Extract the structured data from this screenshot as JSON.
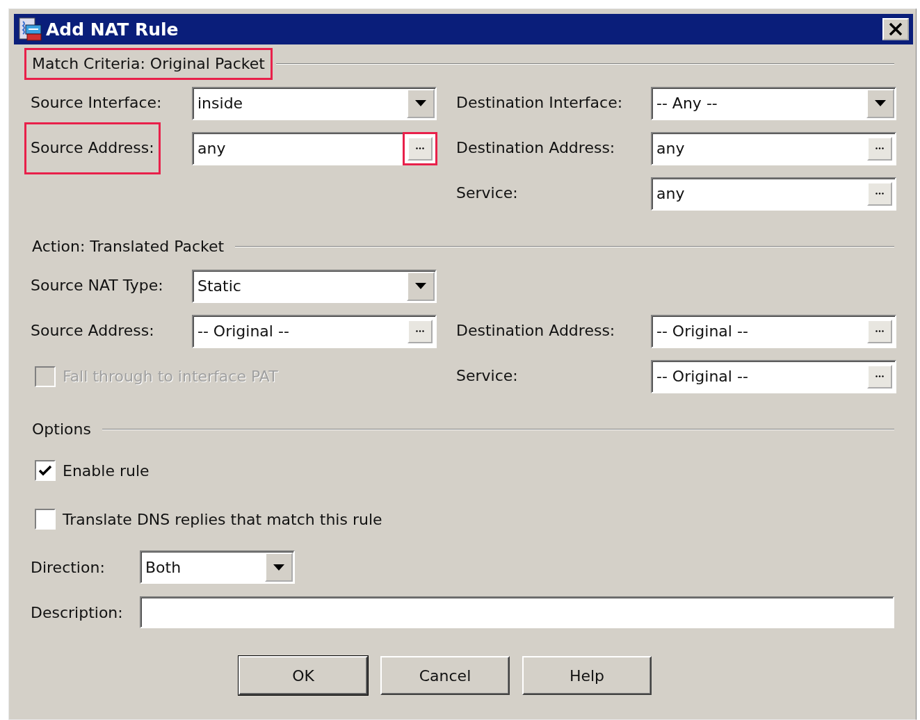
{
  "window": {
    "title": "Add NAT Rule"
  },
  "match": {
    "title": "Match Criteria: Original Packet",
    "highlighted": true,
    "rows": [
      {
        "left": {
          "kind": "dropdown",
          "label": "Source Interface:",
          "value": "inside",
          "label_highlighted": false
        },
        "right": {
          "kind": "dropdown",
          "label": "Destination Interface:",
          "value": "-- Any --",
          "label_highlighted": false
        }
      },
      {
        "left": {
          "kind": "browse",
          "label": "Source Address:",
          "value": "any",
          "label_highlighted": true,
          "button_highlighted": true
        },
        "right": {
          "kind": "browse",
          "label": "Destination Address:",
          "value": "any",
          "label_highlighted": false,
          "button_highlighted": false
        }
      },
      {
        "right": {
          "kind": "browse",
          "label": "Service:",
          "value": "any",
          "label_highlighted": false,
          "button_highlighted": false
        }
      }
    ]
  },
  "action": {
    "title": "Action: Translated Packet",
    "highlighted": false,
    "rows": [
      {
        "left": {
          "kind": "dropdown",
          "label": "Source NAT Type:",
          "value": "Static",
          "label_highlighted": false
        }
      },
      {
        "left": {
          "kind": "browse",
          "label": "Source Address:",
          "value": "-- Original --",
          "label_highlighted": false,
          "button_highlighted": false
        },
        "right": {
          "kind": "browse",
          "label": "Destination Address:",
          "value": "-- Original --",
          "label_highlighted": false,
          "button_highlighted": false
        }
      },
      {
        "left": {
          "kind": "checkbox",
          "label": "Fall through to interface PAT",
          "checked": false,
          "disabled": true
        },
        "right": {
          "kind": "browse",
          "label": "Service:",
          "value": "-- Original --",
          "label_highlighted": false,
          "button_highlighted": false
        }
      }
    ]
  },
  "options": {
    "title": "Options",
    "checkboxes": [
      {
        "label": "Enable rule",
        "checked": true,
        "disabled": false
      },
      {
        "label": "Translate DNS replies that match this rule",
        "checked": false,
        "disabled": false
      }
    ],
    "direction": {
      "label": "Direction:",
      "value": "Both"
    },
    "description": {
      "label": "Description:"
    }
  },
  "buttons": [
    "OK",
    "Cancel",
    "Help"
  ]
}
